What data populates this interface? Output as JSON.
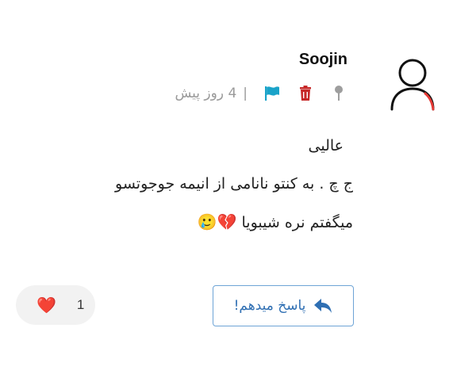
{
  "comment": {
    "username": "Soojin",
    "time": "4 روز پیش",
    "separator": "|",
    "icons": {
      "avatar": "user-outline-icon",
      "pin": "pin-icon",
      "delete": "trash-icon",
      "report": "flag-icon",
      "reply": "reply-arrow-icon",
      "like": "heart-icon"
    },
    "text_lines": [
      "عالیی",
      "ج چ . به کنتو نانامی از انیمه جوجوتسو",
      "میگفتم نره شیبویا"
    ],
    "line3_emojis": "💔🥲",
    "reply_label": "پاسخ میدهم!",
    "like_emoji": "❤️",
    "like_count": "1"
  },
  "colors": {
    "delete": "#c62828",
    "report": "#1aa3c9",
    "pin": "#9e9e9e",
    "reply_border": "#6ea4d6",
    "reply_text": "#2f6fb3",
    "avatar_accent": "#e53935",
    "meta_text": "#9a9a9a",
    "like_bg": "#f2f2f2"
  }
}
